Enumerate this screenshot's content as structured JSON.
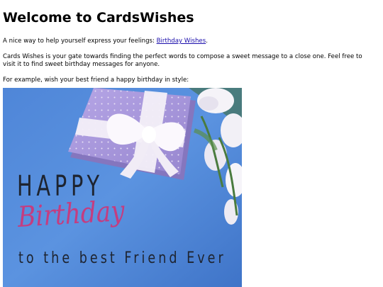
{
  "page": {
    "title": "Welcome to CardsWishes",
    "intro_prefix": "A nice way to help yourself express your feelings: ",
    "intro_link": "Birthday Wishes",
    "intro_suffix": ".",
    "description": "Cards Wishes is your gate towards finding the perfect words to compose a sweet message to a close one. Feel free to visit it to find sweet birthday messages for anyone.",
    "example": "For example, wish your best friend a happy birthday in style:"
  },
  "card": {
    "line1": "HAPPY",
    "line2": "Birthday",
    "line3": "to the best Friend Ever"
  },
  "colors": {
    "background": "#5b8fdc",
    "gift": "#a898d8",
    "ribbon": "#f2eef6",
    "birthday_text": "#c43d80",
    "dark_text": "#1e2430",
    "link": "#1a0dab"
  }
}
